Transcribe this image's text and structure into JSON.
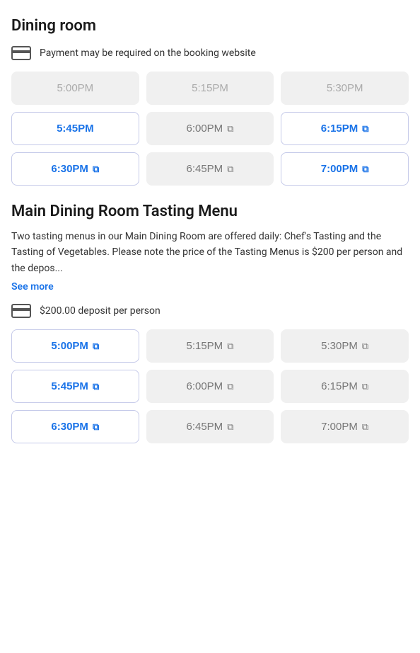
{
  "dining_room": {
    "title": "Dining room",
    "payment_notice": "Payment may be required on the booking website",
    "time_slots": [
      {
        "time": "5:00PM",
        "state": "unavailable",
        "has_external": false
      },
      {
        "time": "5:15PM",
        "state": "unavailable",
        "has_external": false
      },
      {
        "time": "5:30PM",
        "state": "unavailable",
        "has_external": false
      },
      {
        "time": "5:45PM",
        "state": "available",
        "has_external": false
      },
      {
        "time": "6:00PM",
        "state": "available-gray",
        "has_external": true
      },
      {
        "time": "6:15PM",
        "state": "available",
        "has_external": true
      },
      {
        "time": "6:30PM",
        "state": "available",
        "has_external": true
      },
      {
        "time": "6:45PM",
        "state": "available-gray",
        "has_external": true
      },
      {
        "time": "7:00PM",
        "state": "available",
        "has_external": true
      }
    ]
  },
  "tasting_menu": {
    "title": "Main Dining Room Tasting Menu",
    "description": "Two tasting menus in our Main Dining Room are offered daily: Chef's Tasting and the Tasting of Vegetables. Please note the price of the Tasting Menus is $200 per person and the depos...",
    "see_more_label": "See more",
    "deposit_notice": "$200.00 deposit per person",
    "time_slots": [
      {
        "time": "5:00PM",
        "state": "available",
        "has_external": true
      },
      {
        "time": "5:15PM",
        "state": "available-gray",
        "has_external": true
      },
      {
        "time": "5:30PM",
        "state": "available-gray",
        "has_external": true
      },
      {
        "time": "5:45PM",
        "state": "available",
        "has_external": true
      },
      {
        "time": "6:00PM",
        "state": "available-gray",
        "has_external": true
      },
      {
        "time": "6:15PM",
        "state": "available-gray",
        "has_external": true
      },
      {
        "time": "6:30PM",
        "state": "available",
        "has_external": true
      },
      {
        "time": "6:45PM",
        "state": "available-gray",
        "has_external": true
      },
      {
        "time": "7:00PM",
        "state": "available-gray",
        "has_external": true
      }
    ]
  },
  "icons": {
    "external_link": "⧉",
    "card": "💳"
  }
}
